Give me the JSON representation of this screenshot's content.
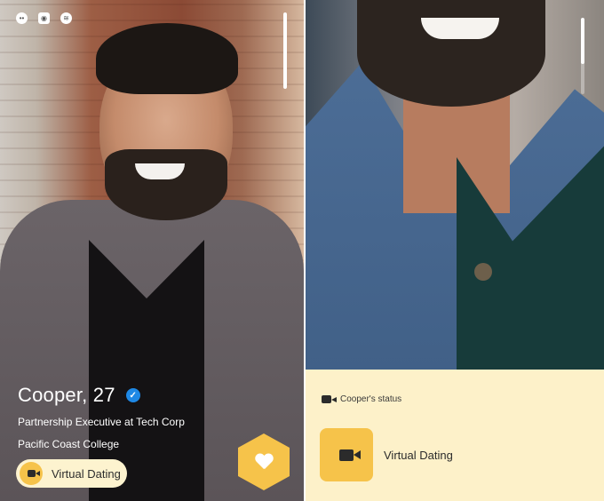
{
  "left_card": {
    "status_icons": [
      "circle-status-icon",
      "camera-status-icon",
      "wifi-status-icon"
    ],
    "name_age": "Cooper, 27",
    "verified": "✓",
    "job": "Partnership Executive at Tech Corp",
    "school": "Pacific Coast College",
    "virtual_dating_label": "Virtual Dating",
    "photo_progress": 1.0
  },
  "right_card": {
    "status_label": "Cooper's status",
    "virtual_dating_label": "Virtual Dating",
    "photo_progress": 0.6
  },
  "colors": {
    "accent": "#f6c34a",
    "card_background": "#fdf1c9",
    "pill_background": "#fdf3cf",
    "verified_blue": "#1e88e5"
  }
}
